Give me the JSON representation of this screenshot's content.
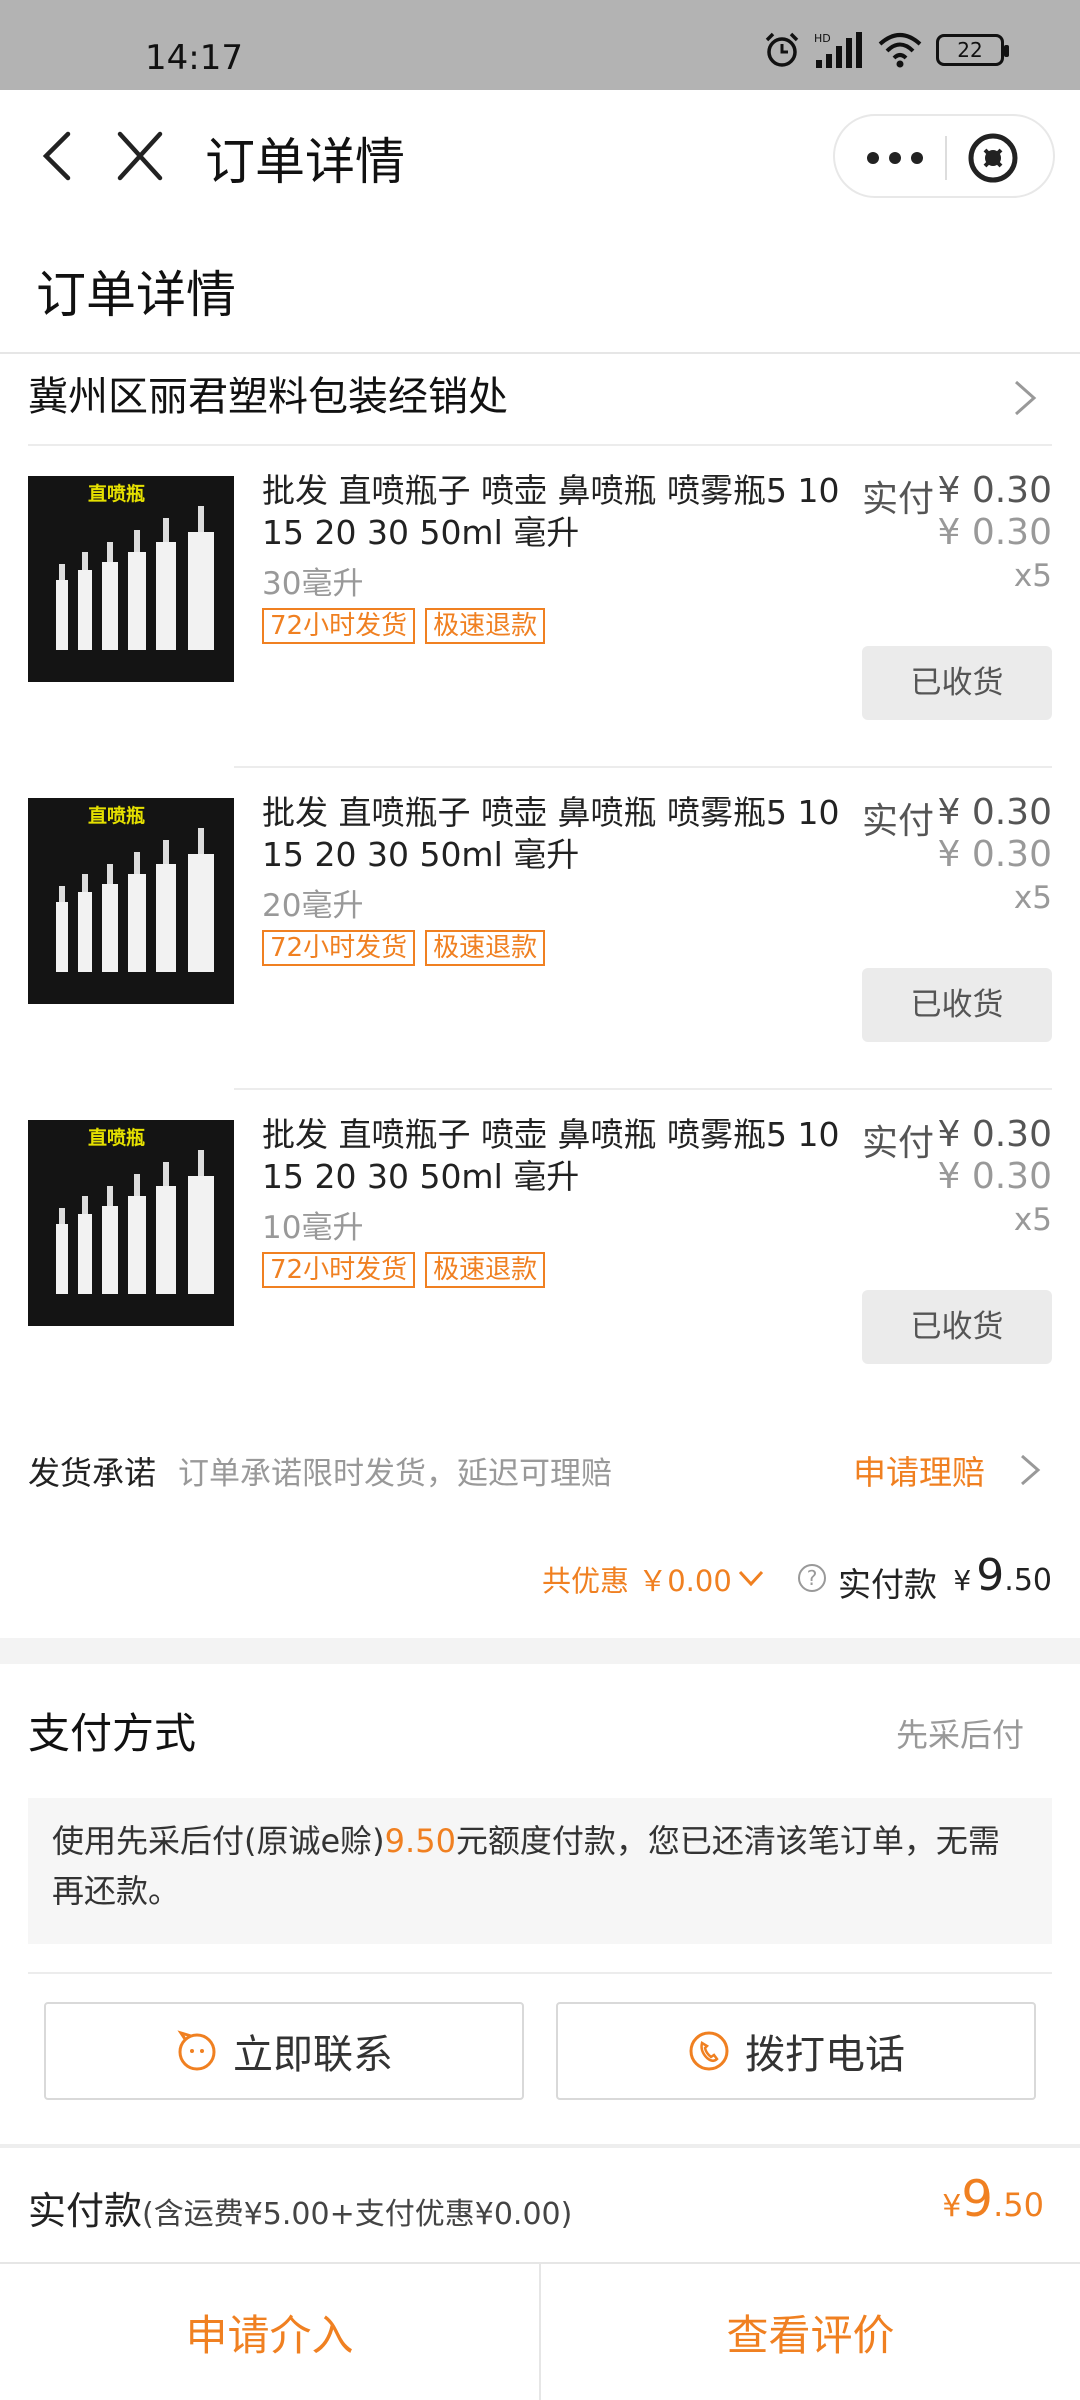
{
  "status_bar": {
    "time": "14:17",
    "battery": "22",
    "network": "HD"
  },
  "nav": {
    "title": "订单详情"
  },
  "page": {
    "heading": "订单详情"
  },
  "shop": {
    "name": "冀州区丽君塑料包装经销处"
  },
  "items": [
    {
      "title": "批发 直喷瓶子 喷壶 鼻喷瓶 喷雾瓶5 10 15 20 30 50ml 毫升",
      "price_label": "实付",
      "price": "¥ 0.30",
      "original_price": "¥ 0.30",
      "spec": "30毫升",
      "quantity": "x5",
      "tags": [
        "72小时发货",
        "极速退款"
      ],
      "status": "已收货",
      "image_text": "直喷瓶"
    },
    {
      "title": "批发 直喷瓶子 喷壶 鼻喷瓶 喷雾瓶5 10 15 20 30 50ml 毫升",
      "price_label": "实付",
      "price": "¥ 0.30",
      "original_price": "¥ 0.30",
      "spec": "20毫升",
      "quantity": "x5",
      "tags": [
        "72小时发货",
        "极速退款"
      ],
      "status": "已收货",
      "image_text": "直喷瓶"
    },
    {
      "title": "批发 直喷瓶子 喷壶 鼻喷瓶 喷雾瓶5 10 15 20 30 50ml 毫升",
      "price_label": "实付",
      "price": "¥ 0.30",
      "original_price": "¥ 0.30",
      "spec": "10毫升",
      "quantity": "x5",
      "tags": [
        "72小时发货",
        "极速退款"
      ],
      "status": "已收货",
      "image_text": "直喷瓶"
    }
  ],
  "promise": {
    "label": "发货承诺",
    "desc": "订单承诺限时发货，延迟可理赔",
    "action": "申请理赔"
  },
  "summary": {
    "discount": "共优惠 ￥0.00",
    "paid_label": "实付款",
    "currency": "¥",
    "amount_int": "9",
    "amount_dec": ".50"
  },
  "payment": {
    "title": "支付方式",
    "method": "先采后付",
    "note_prefix": "使用先采后付(原诚e赊)",
    "note_amount": "9.50",
    "note_suffix": "元额度付款，您已还清该笔订单，无需再还款。"
  },
  "actions": {
    "contact": "立即联系",
    "call": "拨打电话"
  },
  "bottom_pay": {
    "label": "实付款",
    "detail": "(含运费¥5.00+支付优惠¥0.00)",
    "currency": "¥",
    "amount_int": "9",
    "amount_dec": ".50"
  },
  "bottom_bar": {
    "intervene": "申请介入",
    "review": "查看评价"
  },
  "colors": {
    "accent": "#f08021",
    "status_bar": "#b3b3b3",
    "muted": "#999999"
  }
}
